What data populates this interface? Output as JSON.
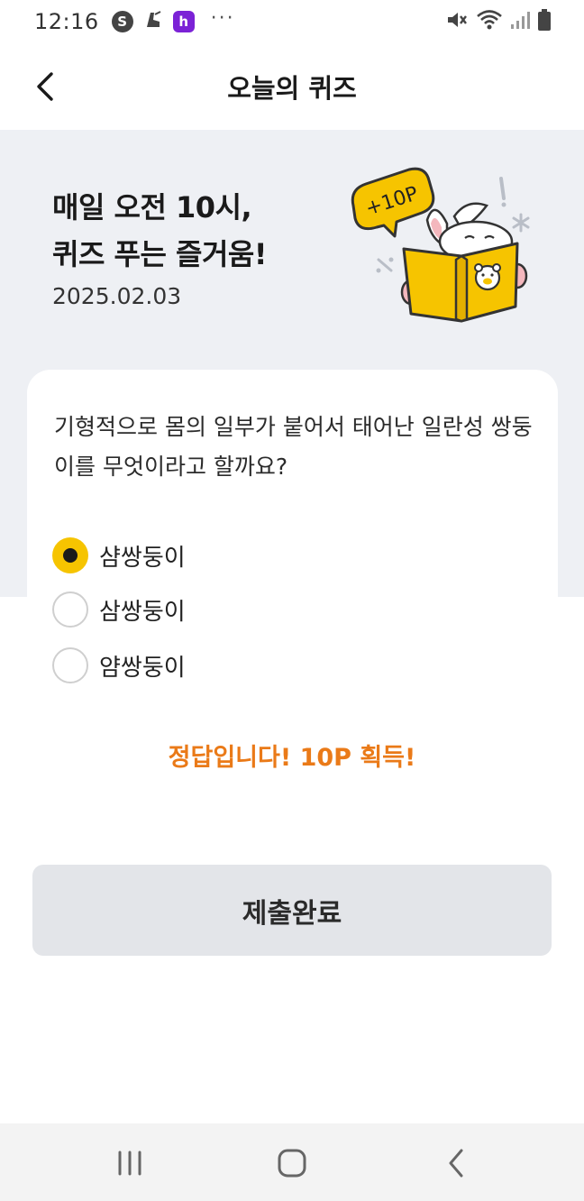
{
  "status_bar": {
    "time": "12:16",
    "left_icons": [
      "s-app-icon",
      "boot-icon",
      "h-app-icon",
      "more-dots-icon"
    ],
    "right_icons": [
      "mute-icon",
      "wifi-icon",
      "signal-icon",
      "battery-icon"
    ],
    "s_glyph": "S",
    "h_glyph": "h",
    "dots": "···"
  },
  "header": {
    "title": "오늘의 퀴즈",
    "back_icon": "chevron-left-icon"
  },
  "banner": {
    "title_line1": "매일 오전 10시,",
    "title_line2": "퀴즈 푸는 즐거움!",
    "date": "2025.02.03",
    "badge": "+10P",
    "illustration": "rabbit-reading-book-illustration",
    "accent_color": "#f6c400",
    "background_color": "#eef0f4"
  },
  "quiz": {
    "question": "기형적으로 몸의 일부가 붙어서 태어난 일란성 쌍둥이를 무엇이라고 할까요?",
    "options": [
      {
        "label": "샴쌍둥이",
        "selected": true
      },
      {
        "label": "삼쌍둥이",
        "selected": false
      },
      {
        "label": "얌쌍둥이",
        "selected": false
      }
    ],
    "result": "정답입니다! 10P 획득!",
    "result_color": "#ea7a18",
    "submit_label": "제출완료"
  },
  "nav_bar": {
    "items": [
      "recent-apps-icon",
      "home-icon",
      "back-icon"
    ]
  }
}
